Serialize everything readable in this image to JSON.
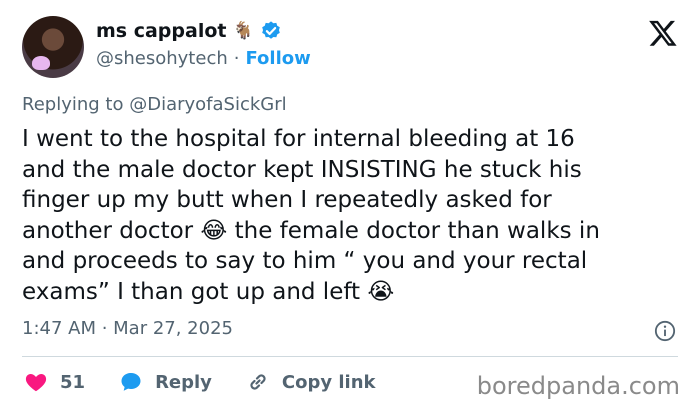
{
  "author": {
    "display_name": "ms cappalot",
    "name_emoji": "🐐",
    "handle": "@shesohytech",
    "separator": "·",
    "follow_label": "Follow"
  },
  "reply": {
    "prefix": "Replying to",
    "mention": "@DiaryofaSickGrl"
  },
  "tweet": {
    "text": "I went to the hospital for internal bleeding at 16\nand the male doctor kept INSISTING he stuck his\nfinger up my butt when I repeatedly asked for\nanother doctor 😂 the female doctor than walks in\nand proceeds to say to him “ you and your rectal\nexams” I than got up and left 😭",
    "timestamp": "1:47 AM · Mar 27, 2025"
  },
  "actions": {
    "likes_count": "51",
    "reply_label": "Reply",
    "copy_link_label": "Copy link"
  },
  "watermark": "boredpanda.com",
  "colors": {
    "brand_blue": "#1d9bf0",
    "like_red": "#f91880",
    "muted": "#536471"
  }
}
